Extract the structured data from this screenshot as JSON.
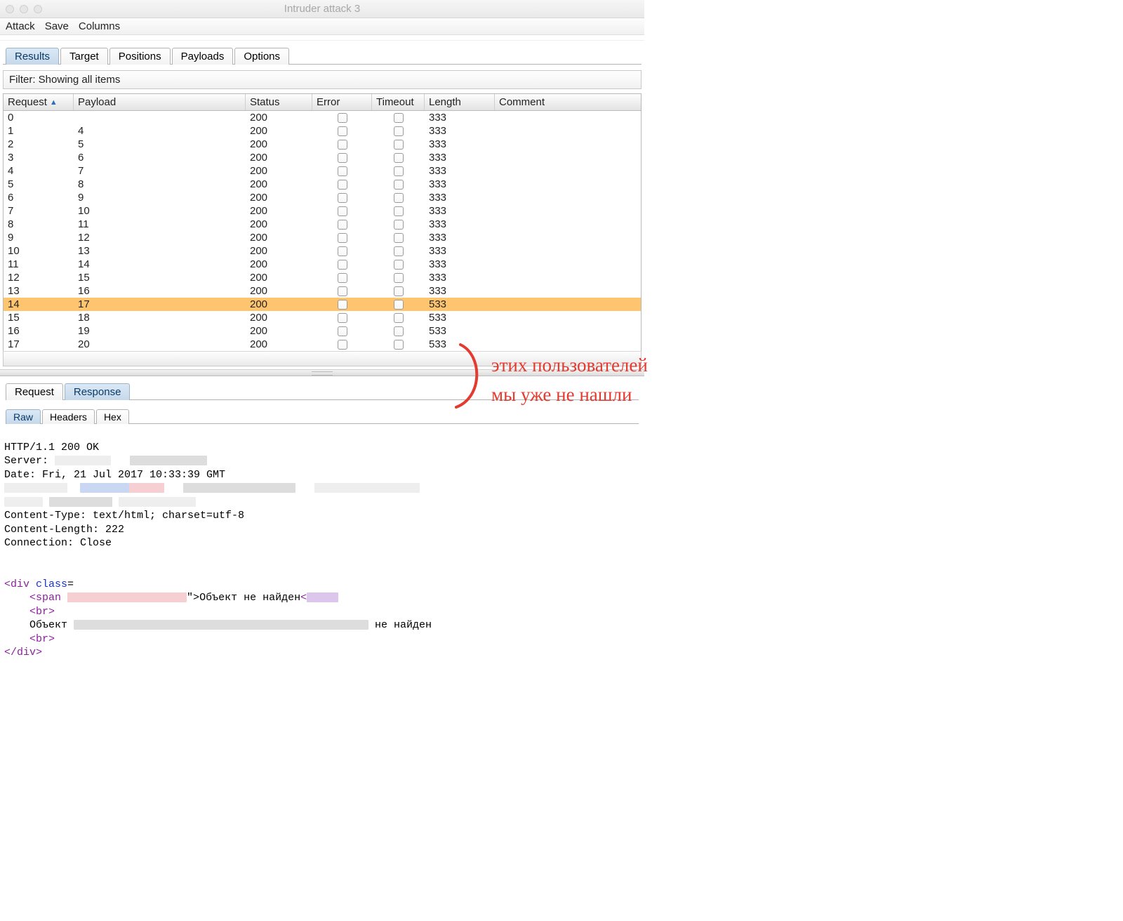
{
  "window": {
    "title": "Intruder attack 3"
  },
  "menu": {
    "attack": "Attack",
    "save": "Save",
    "columns": "Columns"
  },
  "tabs": {
    "results": "Results",
    "target": "Target",
    "positions": "Positions",
    "payloads": "Payloads",
    "options": "Options"
  },
  "filter": {
    "text": "Filter: Showing all items"
  },
  "columns": {
    "request": "Request",
    "payload": "Payload",
    "status": "Status",
    "error": "Error",
    "timeout": "Timeout",
    "length": "Length",
    "comment": "Comment",
    "sort_indicator": "▲"
  },
  "rows": [
    {
      "req": "0",
      "payload": "",
      "status": "200",
      "length": "333"
    },
    {
      "req": "1",
      "payload": "4",
      "status": "200",
      "length": "333"
    },
    {
      "req": "2",
      "payload": "5",
      "status": "200",
      "length": "333"
    },
    {
      "req": "3",
      "payload": "6",
      "status": "200",
      "length": "333"
    },
    {
      "req": "4",
      "payload": "7",
      "status": "200",
      "length": "333"
    },
    {
      "req": "5",
      "payload": "8",
      "status": "200",
      "length": "333"
    },
    {
      "req": "6",
      "payload": "9",
      "status": "200",
      "length": "333"
    },
    {
      "req": "7",
      "payload": "10",
      "status": "200",
      "length": "333"
    },
    {
      "req": "8",
      "payload": "11",
      "status": "200",
      "length": "333"
    },
    {
      "req": "9",
      "payload": "12",
      "status": "200",
      "length": "333"
    },
    {
      "req": "10",
      "payload": "13",
      "status": "200",
      "length": "333"
    },
    {
      "req": "11",
      "payload": "14",
      "status": "200",
      "length": "333"
    },
    {
      "req": "12",
      "payload": "15",
      "status": "200",
      "length": "333"
    },
    {
      "req": "13",
      "payload": "16",
      "status": "200",
      "length": "333"
    },
    {
      "req": "14",
      "payload": "17",
      "status": "200",
      "length": "533",
      "selected": true
    },
    {
      "req": "15",
      "payload": "18",
      "status": "200",
      "length": "533"
    },
    {
      "req": "16",
      "payload": "19",
      "status": "200",
      "length": "533"
    },
    {
      "req": "17",
      "payload": "20",
      "status": "200",
      "length": "533"
    }
  ],
  "subtabs": {
    "request": "Request",
    "response": "Response"
  },
  "innerTabs": {
    "raw": "Raw",
    "headers": "Headers",
    "hex": "Hex"
  },
  "raw": {
    "l1": "HTTP/1.1 200 OK",
    "l2": "Server: ",
    "l3": "Date: Fri, 21 Jul 2017 10:33:39 GMT",
    "l4": "Content-Type: text/html; charset=utf-8",
    "l5": "Content-Length: 222",
    "l6": "Connection: Close",
    "divOpen_lt": "<",
    "divOpen_name": "div ",
    "divOpen_class": "class",
    "divOpen_eq": "=",
    "spanOpen_lt": "<",
    "spanOpen_name": "span ",
    "span_tail_close": "\">",
    "span_text": "Объект не найден",
    "span_close_lt": "<",
    "br1_lt": "<",
    "br1_name": "br",
    "br1_gt": ">",
    "obj_prefix": "    Объект ",
    "obj_suffix": " не найден",
    "br2_lt": "<",
    "br2_name": "br",
    "br2_gt": ">",
    "divClose_lt": "</",
    "divClose_name": "div",
    "divClose_gt": ">"
  },
  "annotation": {
    "line1": "этих пользователей",
    "line2": "мы уже не нашли"
  }
}
